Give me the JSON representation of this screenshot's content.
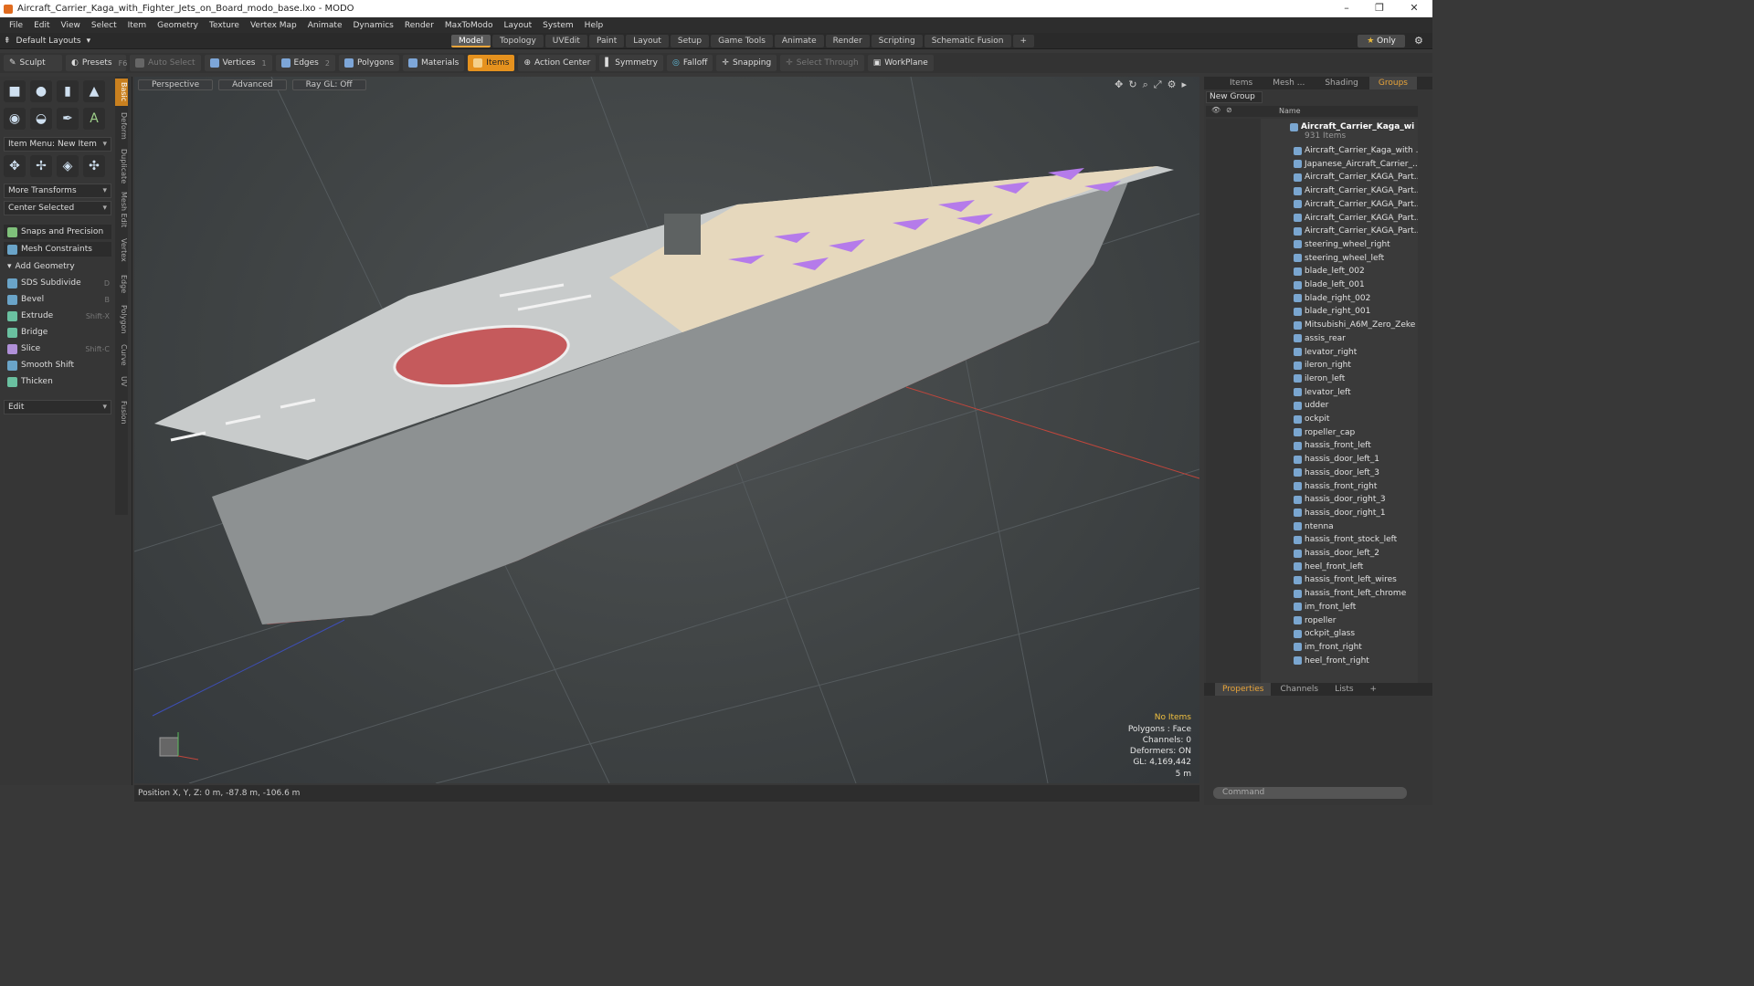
{
  "window": {
    "title": "Aircraft_Carrier_Kaga_with_Fighter_Jets_on_Board_modo_base.lxo - MODO"
  },
  "menu": [
    "File",
    "Edit",
    "View",
    "Select",
    "Item",
    "Geometry",
    "Texture",
    "Vertex Map",
    "Animate",
    "Dynamics",
    "Render",
    "MaxToModo",
    "Layout",
    "System",
    "Help"
  ],
  "layout": {
    "label": "Default Layouts",
    "tabs": [
      "Model",
      "Topology",
      "UVEdit",
      "Paint",
      "Layout",
      "Setup",
      "Game Tools",
      "Animate",
      "Render",
      "Scripting",
      "Schematic Fusion"
    ],
    "active_tab": "Model",
    "only": "Only"
  },
  "toolbar": {
    "sculpt": "Sculpt",
    "presets": "Presets",
    "presets_key": "F6",
    "auto_select": "Auto Select",
    "vertices": "Vertices",
    "vertices_n": "1",
    "edges": "Edges",
    "edges_n": "2",
    "polygons": "Polygons",
    "materials": "Materials",
    "items": "Items",
    "action_center": "Action Center",
    "symmetry": "Symmetry",
    "falloff": "Falloff",
    "snapping": "Snapping",
    "select_through": "Select Through",
    "workplane": "WorkPlane"
  },
  "left": {
    "vtabs": [
      "Basic",
      "Deform",
      "Duplicate",
      "Mesh Edit",
      "Vertex",
      "Edge",
      "Polygon",
      "Curve",
      "UV",
      "Fusion"
    ],
    "item_menu": "Item Menu: New Item",
    "more_transforms": "More Transforms",
    "center_selected": "Center Selected",
    "snaps": "Snaps and Precision",
    "mesh_constraints": "Mesh Constraints",
    "add_geometry": "Add Geometry",
    "tools": [
      {
        "label": "SDS Subdivide",
        "key": "D"
      },
      {
        "label": "Bevel",
        "key": "B"
      },
      {
        "label": "Extrude",
        "key": "Shift-X"
      },
      {
        "label": "Bridge",
        "key": ""
      },
      {
        "label": "Slice",
        "key": "Shift-C"
      },
      {
        "label": "Smooth Shift",
        "key": ""
      },
      {
        "label": "Thicken",
        "key": ""
      }
    ],
    "edit": "Edit"
  },
  "viewport": {
    "perspective": "Perspective",
    "advanced": "Advanced",
    "raygl": "Ray GL: Off",
    "stats": {
      "no_items": "No Items",
      "polygons": "Polygons : Face",
      "channels": "Channels: 0",
      "deformers": "Deformers: ON",
      "gl": "GL: 4,169,442",
      "scale": "5 m"
    }
  },
  "status": {
    "position": "Position X, Y, Z:  0 m, -87.8 m, -106.6 m"
  },
  "right": {
    "tabs": [
      "Items",
      "Mesh ...",
      "Shading",
      "Groups"
    ],
    "active_tab": "Groups",
    "new_group": "New Group",
    "name_col": "Name",
    "root": "Aircraft_Carrier_Kaga_wi ...",
    "count": "931 Items",
    "items": [
      "Aircraft_Carrier_Kaga_with ...",
      "Japanese_Aircraft_Carrier_...",
      "Aircraft_Carrier_KAGA_Part...",
      "Aircraft_Carrier_KAGA_Part...",
      "Aircraft_Carrier_KAGA_Part...",
      "Aircraft_Carrier_KAGA_Part...",
      "Aircraft_Carrier_KAGA_Part...",
      "steering_wheel_right",
      "steering_wheel_left",
      "blade_left_002",
      "blade_left_001",
      "blade_right_002",
      "blade_right_001",
      "Mitsubishi_A6M_Zero_Zeke",
      "assis_rear",
      "levator_right",
      "ileron_right",
      "ileron_left",
      "levator_left",
      "udder",
      "ockpit",
      "ropeller_cap",
      "hassis_front_left",
      "hassis_door_left_1",
      "hassis_door_left_3",
      "hassis_front_right",
      "hassis_door_right_3",
      "hassis_door_right_1",
      "ntenna",
      "hassis_front_stock_left",
      "hassis_door_left_2",
      "heel_front_left",
      "hassis_front_left_wires",
      "hassis_front_left_chrome",
      "im_front_left",
      "ropeller",
      "ockpit_glass",
      "im_front_right",
      "heel_front_right"
    ],
    "bottom_tabs": [
      "Properties",
      "Channels",
      "Lists"
    ],
    "command": "Command"
  }
}
